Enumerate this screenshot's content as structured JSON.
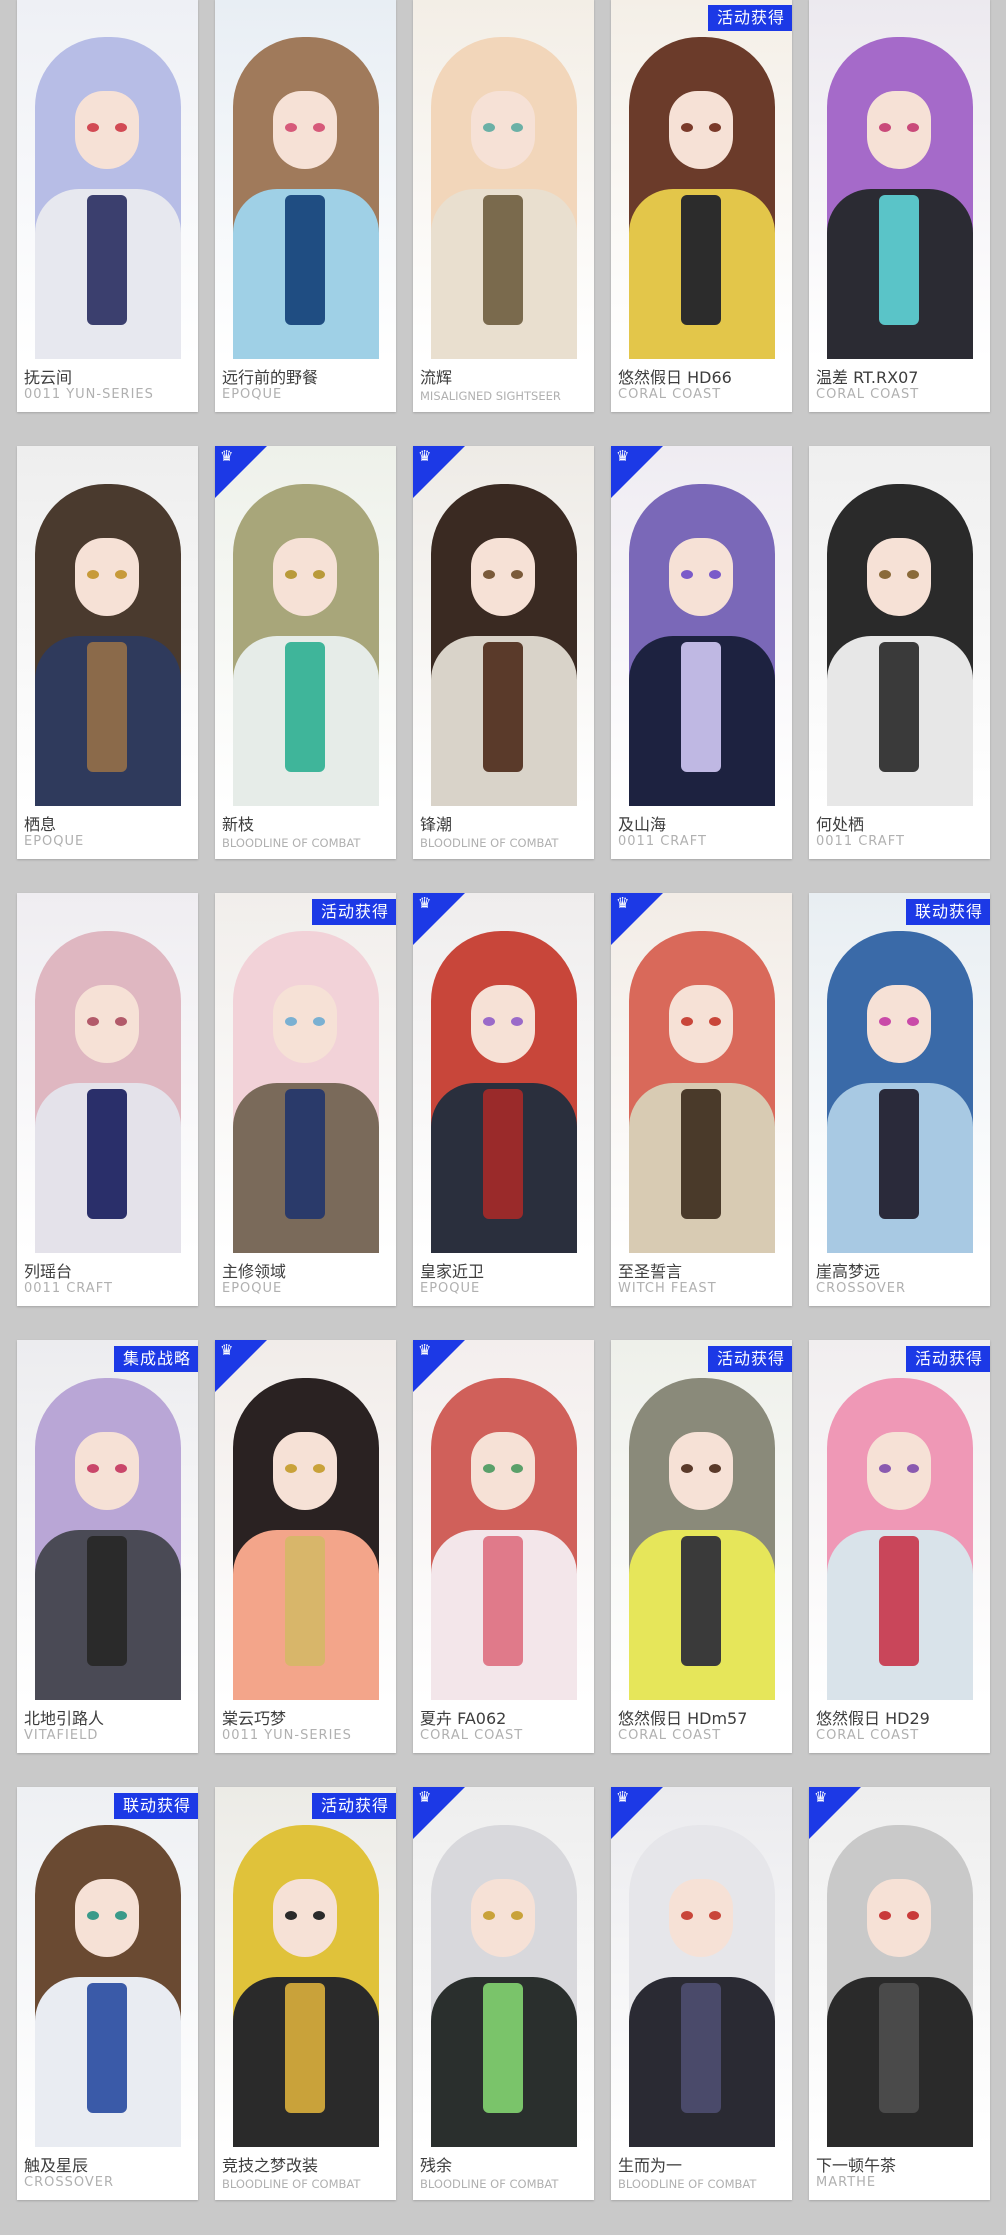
{
  "colors": {
    "background": "#c9c9c9",
    "card": "#ffffff",
    "badge_blue": "#1c39e6",
    "name_text": "#3d3d3d",
    "series_text": "#b0b0b0"
  },
  "cards": [
    {
      "name": "抚云间",
      "series": "0011 YUN-SERIES",
      "badge": "",
      "corner_icon": "",
      "bg_text": "",
      "palette": {
        "bg": "#eef0f5",
        "hair": "#b7bde6",
        "eye": "#d24a54",
        "body": "#e7e8ef",
        "accent": "#3b3f6e"
      }
    },
    {
      "name": "远行前的野餐",
      "series": "EPOQUE",
      "badge": "",
      "corner_icon": "",
      "bg_text": "",
      "palette": {
        "bg": "#e8eef4",
        "hair": "#a07a5b",
        "eye": "#d65a7a",
        "body": "#9fd0e6",
        "accent": "#1f4d82"
      }
    },
    {
      "name": "流辉",
      "series": "MISALIGNED SIGHTSEER",
      "badge": "",
      "corner_icon": "",
      "bg_text": "",
      "palette": {
        "bg": "#f3eee6",
        "hair": "#f2d6ba",
        "eye": "#6bb0a6",
        "body": "#e9dfcf",
        "accent": "#7a6a4d"
      }
    },
    {
      "name": "悠然假日 HD66",
      "series": "CORAL COAST",
      "badge": "活动获得",
      "corner_icon": "",
      "bg_text": "",
      "palette": {
        "bg": "#f4efe7",
        "hair": "#6b3b2a",
        "eye": "#7a3a2a",
        "body": "#e3c64a",
        "accent": "#2c2c2c"
      }
    },
    {
      "name": "温差 RT.RX07",
      "series": "CORAL COAST",
      "badge": "",
      "corner_icon": "",
      "bg_text": "",
      "palette": {
        "bg": "#ece9ef",
        "hair": "#a56ac9",
        "eye": "#c94a7a",
        "body": "#2b2b33",
        "accent": "#5ac4c8"
      }
    },
    {
      "name": "栖息",
      "series": "EPOQUE",
      "badge": "",
      "corner_icon": "",
      "bg_text": "",
      "palette": {
        "bg": "#eeeeee",
        "hair": "#4a3a2e",
        "eye": "#c79a3a",
        "body": "#2f3a5c",
        "accent": "#8b6a4a"
      }
    },
    {
      "name": "新枝",
      "series": "BLOODLINE OF COMBAT",
      "badge": "",
      "corner_icon": "♛",
      "bg_text": "",
      "palette": {
        "bg": "#eef1ea",
        "hair": "#a8a67a",
        "eye": "#b99a3a",
        "body": "#e6ece8",
        "accent": "#3fb59a"
      }
    },
    {
      "name": "锋潮",
      "series": "BLOODLINE OF COMBAT",
      "badge": "",
      "corner_icon": "♛",
      "bg_text": "",
      "palette": {
        "bg": "#eeebe6",
        "hair": "#3a2a22",
        "eye": "#7a5a3a",
        "body": "#d9d3c9",
        "accent": "#5a3a2a"
      }
    },
    {
      "name": "及山海",
      "series": "0011 CRAFT",
      "badge": "",
      "corner_icon": "♛",
      "bg_text": "",
      "palette": {
        "bg": "#efecf2",
        "hair": "#7a68b8",
        "eye": "#7a5ac9",
        "body": "#1d2240",
        "accent": "#bfb8e3"
      }
    },
    {
      "name": "何处栖",
      "series": "0011 CRAFT",
      "badge": "",
      "corner_icon": "",
      "bg_text": "",
      "palette": {
        "bg": "#efefef",
        "hair": "#2a2a2a",
        "eye": "#8a6a3a",
        "body": "#e7e7e7",
        "accent": "#3a3a3a"
      }
    },
    {
      "name": "列瑶台",
      "series": "0011 CRAFT",
      "badge": "",
      "corner_icon": "",
      "bg_text": "",
      "palette": {
        "bg": "#efedf1",
        "hair": "#dfb7c1",
        "eye": "#b25a6a",
        "body": "#e4e2ea",
        "accent": "#2a2f6a"
      }
    },
    {
      "name": "主修领域",
      "series": "EPOQUE",
      "badge": "活动获得",
      "corner_icon": "",
      "bg_text": "",
      "palette": {
        "bg": "#f1eeeb",
        "hair": "#f2d2d8",
        "eye": "#7ab0d2",
        "body": "#7a6a5a",
        "accent": "#2a3a6a"
      }
    },
    {
      "name": "皇家近卫",
      "series": "EPOQUE",
      "badge": "",
      "corner_icon": "♛",
      "bg_text": "",
      "palette": {
        "bg": "#efeded",
        "hair": "#c8463a",
        "eye": "#9a6ac9",
        "body": "#2a2f3d",
        "accent": "#9a2a2a"
      }
    },
    {
      "name": "至圣誓言",
      "series": "WITCH FEAST",
      "badge": "",
      "corner_icon": "♛",
      "bg_text": "",
      "palette": {
        "bg": "#f2ece6",
        "hair": "#d9695a",
        "eye": "#c9463a",
        "body": "#d8cbb3",
        "accent": "#4a3a2a"
      }
    },
    {
      "name": "崖高梦远",
      "series": "CROSSOVER",
      "badge": "联动获得",
      "corner_icon": "",
      "bg_text": "",
      "palette": {
        "bg": "#e8eef2",
        "hair": "#3a6aa8",
        "eye": "#c94aa8",
        "body": "#a8c9e3",
        "accent": "#2a2a3a"
      }
    },
    {
      "name": "北地引路人",
      "series": "VITAFIELD",
      "badge": "集成战略",
      "corner_icon": "",
      "bg_text": "",
      "palette": {
        "bg": "#ececef",
        "hair": "#b9a6d6",
        "eye": "#c9466a",
        "body": "#4a4a55",
        "accent": "#2a2a2a"
      }
    },
    {
      "name": "棠云巧梦",
      "series": "0011 YUN-SERIES",
      "badge": "",
      "corner_icon": "♛",
      "bg_text": "",
      "palette": {
        "bg": "#f1ece9",
        "hair": "#2a2222",
        "eye": "#c9a23a",
        "body": "#f3a58a",
        "accent": "#d8b66a"
      }
    },
    {
      "name": "夏卉 FA062",
      "series": "CORAL COAST",
      "badge": "",
      "corner_icon": "♛",
      "bg_text": "",
      "palette": {
        "bg": "#f3eeed",
        "hair": "#d0605a",
        "eye": "#5aa06a",
        "body": "#f3e6ea",
        "accent": "#e07a8a"
      }
    },
    {
      "name": "悠然假日 HDm57",
      "series": "CORAL COAST",
      "badge": "活动获得",
      "corner_icon": "",
      "bg_text": "",
      "palette": {
        "bg": "#eef0ea",
        "hair": "#8a8a7a",
        "eye": "#5a3a2a",
        "body": "#e6e65a",
        "accent": "#3a3a3a"
      }
    },
    {
      "name": "悠然假日 HD29",
      "series": "CORAL COAST",
      "badge": "活动获得",
      "corner_icon": "",
      "bg_text": "",
      "palette": {
        "bg": "#f1eeef",
        "hair": "#ef98b6",
        "eye": "#8a5ab0",
        "body": "#d9e3ea",
        "accent": "#c9465a"
      }
    },
    {
      "name": "触及星辰",
      "series": "CROSSOVER",
      "badge": "联动获得",
      "corner_icon": "",
      "bg_text": "",
      "palette": {
        "bg": "#eef0f3",
        "hair": "#6a4a32",
        "eye": "#3a9a8a",
        "body": "#e9ecf2",
        "accent": "#3a5aa8"
      }
    },
    {
      "name": "竞技之梦改装",
      "series": "BLOODLINE OF COMBAT",
      "badge": "活动获得",
      "corner_icon": "",
      "bg_text": "",
      "palette": {
        "bg": "#ecebe6",
        "hair": "#e0c23a",
        "eye": "#2a2a2a",
        "body": "#2a2a2a",
        "accent": "#c9a23a"
      }
    },
    {
      "name": "残余",
      "series": "BLOODLINE OF COMBAT",
      "badge": "",
      "corner_icon": "♛",
      "bg_text": "",
      "palette": {
        "bg": "#eeeeee",
        "hair": "#d8d8dc",
        "eye": "#c9a23a",
        "body": "#2a2f2d",
        "accent": "#7ac46a"
      }
    },
    {
      "name": "生而为一",
      "series": "BLOODLINE OF COMBAT",
      "badge": "",
      "corner_icon": "♛",
      "bg_text": "",
      "palette": {
        "bg": "#ebebee",
        "hair": "#e6e6ea",
        "eye": "#c9463a",
        "body": "#2a2a33",
        "accent": "#4a4a6a"
      }
    },
    {
      "name": "下一顿午茶",
      "series": "MARTHE",
      "badge": "",
      "corner_icon": "♛",
      "bg_text": "",
      "palette": {
        "bg": "#eeeeee",
        "hair": "#c9c9c9",
        "eye": "#c93a3a",
        "body": "#2a2a2a",
        "accent": "#4a4a4a"
      }
    }
  ]
}
